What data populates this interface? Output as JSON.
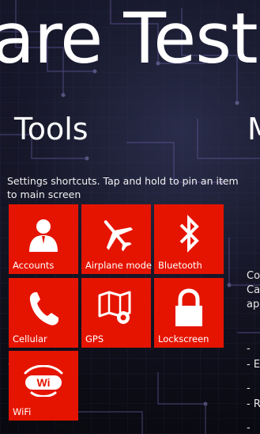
{
  "panorama": {
    "title": "are Test"
  },
  "sections": {
    "current_title": "Tools",
    "next_title": "M"
  },
  "description": "Settings shortcuts. Tap and hold to pin an item to main screen",
  "tiles": [
    {
      "label": "Accounts",
      "icon": "person-icon"
    },
    {
      "label": "Airplane mode",
      "icon": "airplane-icon"
    },
    {
      "label": "Bluetooth",
      "icon": "bluetooth-icon"
    },
    {
      "label": "Cellular",
      "icon": "phone-icon"
    },
    {
      "label": "GPS",
      "icon": "map-pin-icon"
    },
    {
      "label": "Lockscreen",
      "icon": "lock-icon"
    },
    {
      "label": "WiFi",
      "icon": "wifi-icon"
    }
  ],
  "tile_color": "#e51400",
  "next_column": {
    "lines": [
      "Co",
      "Ca",
      "ap",
      "-",
      "- E",
      "-",
      "- R",
      "-"
    ]
  }
}
